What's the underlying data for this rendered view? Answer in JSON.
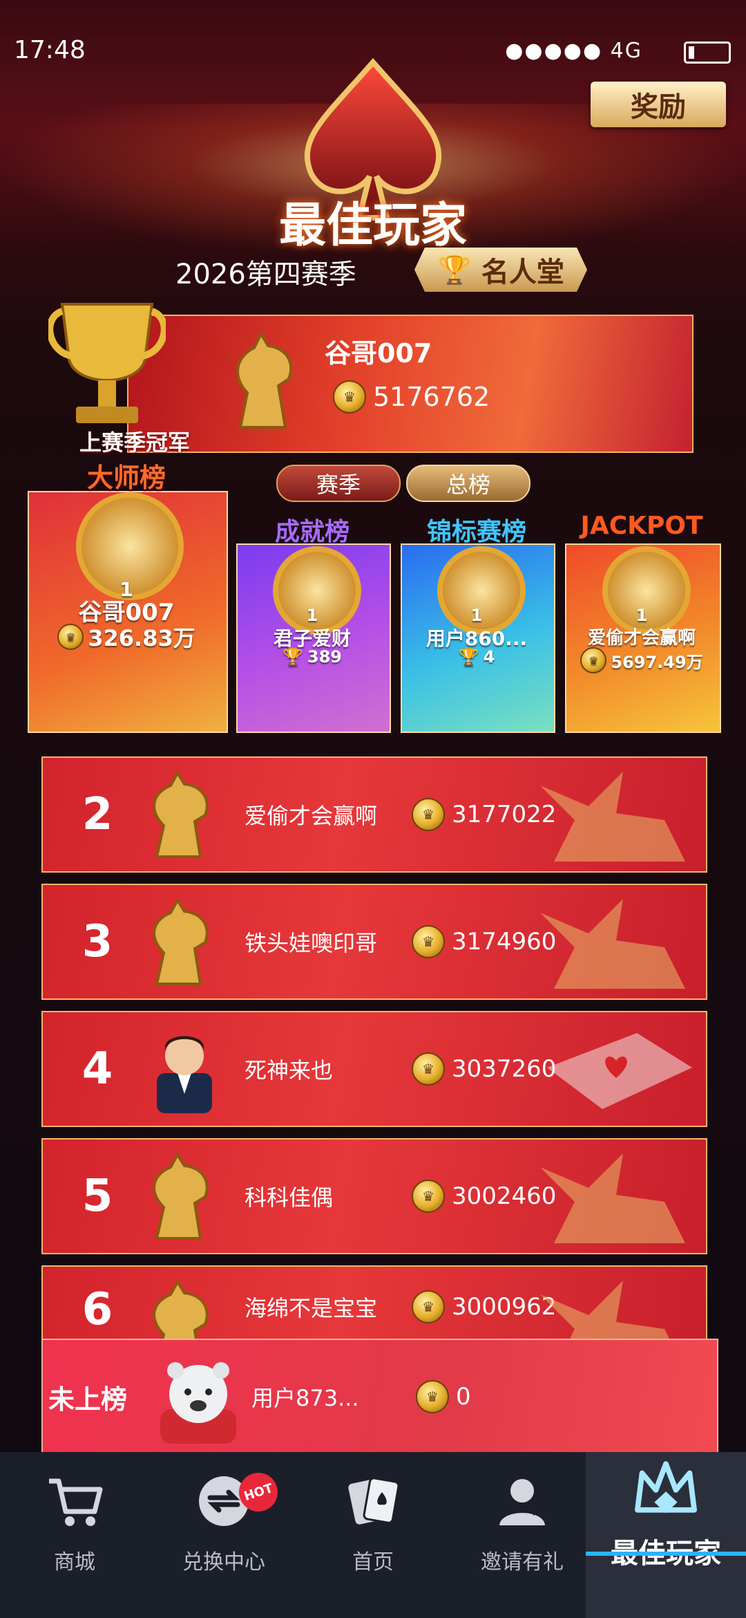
{
  "status_bar": {
    "time": "17:48",
    "signal": "●●●●● 4G"
  },
  "header": {
    "reward_button": "奖励",
    "title": "最佳玩家",
    "season": "2026第四赛季",
    "hall_of_fame": "名人堂"
  },
  "champion": {
    "label": "上赛季冠军",
    "name": "谷哥007",
    "coins": "5176762"
  },
  "tabs": {
    "season": "赛季",
    "total": "总榜"
  },
  "boards": [
    {
      "title": "大师榜",
      "rank": "1",
      "name": "谷哥007",
      "value": "326.83万",
      "value_icon": "coin-icon",
      "title_color": "#ff6a2a"
    },
    {
      "title": "成就榜",
      "rank": "1",
      "name": "君子爱财",
      "value": "389",
      "value_icon": "trophy-icon",
      "title_color": "#a86bff"
    },
    {
      "title": "锦标赛榜",
      "rank": "1",
      "name": "用户860...",
      "value": "4",
      "value_icon": "trophy-icon",
      "title_color": "#3fc6ff"
    },
    {
      "title": "JACKPOT",
      "rank": "1",
      "name": "爱偷才会赢啊",
      "value": "5697.49万",
      "value_icon": "coin-icon",
      "title_color": "#ff5a20"
    }
  ],
  "ranking": [
    {
      "rank": "2",
      "name": "爱偷才会赢啊",
      "coins": "3177022",
      "avatar": "golden-horse",
      "deco": "pegasus"
    },
    {
      "rank": "3",
      "name": "铁头娃噢印哥",
      "coins": "3174960",
      "avatar": "golden-horse",
      "deco": "pegasus"
    },
    {
      "rank": "4",
      "name": "死神来也",
      "coins": "3037260",
      "avatar": "tuxedo-man",
      "deco": "card-carpet"
    },
    {
      "rank": "5",
      "name": "科科佳偶",
      "coins": "3002460",
      "avatar": "golden-horse",
      "deco": "pegasus"
    },
    {
      "rank": "6",
      "name": "海绵不是宝宝",
      "coins": "3000962",
      "avatar": "golden-horse",
      "deco": "pegasus"
    }
  ],
  "me": {
    "rank_label": "未上榜",
    "name": "用户873...",
    "coins": "0",
    "avatar": "polar-bear"
  },
  "nav": {
    "items": [
      {
        "label": "商城",
        "icon": "cart-icon"
      },
      {
        "label": "兑换中心",
        "icon": "exchange-icon",
        "badge": "HOT"
      },
      {
        "label": "首页",
        "icon": "cards-icon"
      },
      {
        "label": "邀请有礼",
        "icon": "invite-icon"
      },
      {
        "label": "最佳玩家",
        "icon": "crown-icon",
        "active": true
      }
    ]
  },
  "colors": {
    "accent_blue": "#2ab3ff",
    "gold": "#e4a734",
    "row_red": "#d3232c"
  }
}
